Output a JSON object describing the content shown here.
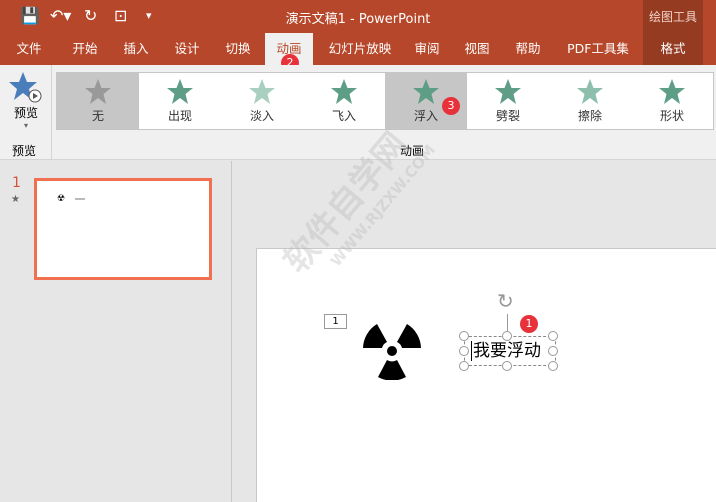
{
  "window": {
    "title": "演示文稿1  -  PowerPoint",
    "context_tab": "绘图工具"
  },
  "quick_access": {
    "save": "save-icon",
    "undo": "undo-icon",
    "redo": "redo-icon",
    "present": "present-icon",
    "customize": "▾"
  },
  "tabs": [
    {
      "label": "文件"
    },
    {
      "label": "开始"
    },
    {
      "label": "插入"
    },
    {
      "label": "设计"
    },
    {
      "label": "切换"
    },
    {
      "label": "动画",
      "active": true
    },
    {
      "label": "幻灯片放映"
    },
    {
      "label": "审阅"
    },
    {
      "label": "视图"
    },
    {
      "label": "帮助"
    },
    {
      "label": "PDF工具集"
    },
    {
      "label": "格式"
    }
  ],
  "ribbon": {
    "preview": {
      "label": "预览",
      "group_label": "预览"
    },
    "animations": [
      {
        "label": "无",
        "color": "#999999"
      },
      {
        "label": "出现",
        "color": "#5f9e86"
      },
      {
        "label": "淡入",
        "color": "#a9cfc0"
      },
      {
        "label": "飞入",
        "color": "#5f9e86"
      },
      {
        "label": "浮入",
        "color": "#5f9e86",
        "selected": true
      },
      {
        "label": "劈裂",
        "color": "#5f9e86"
      },
      {
        "label": "擦除",
        "color": "#8dbfac"
      },
      {
        "label": "形状",
        "color": "#5f9e86"
      }
    ],
    "group_label": "动画"
  },
  "badges": {
    "one": "1",
    "two": "2",
    "three": "3"
  },
  "slides_panel": {
    "number": "1"
  },
  "slide": {
    "animation_tag": "1",
    "textbox": "我要浮动"
  },
  "watermark": {
    "line1": "软件自学网",
    "line2": "WWW.RJZXW.COM"
  },
  "colors": {
    "accent": "#b7472a",
    "badge": "#e8323a",
    "thumb_border": "#f07050"
  }
}
